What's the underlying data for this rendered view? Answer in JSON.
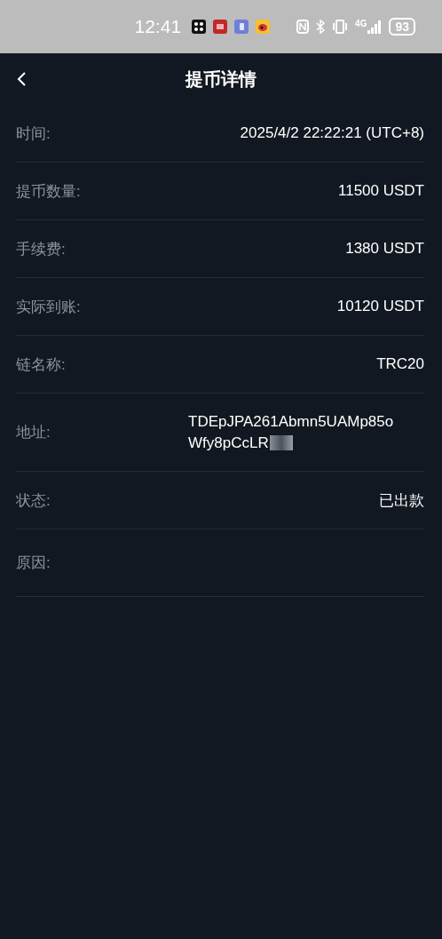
{
  "status_bar": {
    "time": "12:41",
    "network": "4G",
    "battery": "93"
  },
  "header": {
    "title": "提币详情"
  },
  "rows": [
    {
      "kind": "text",
      "label": "时间:",
      "value": "2025/4/2 22:22:21 (UTC+8)"
    },
    {
      "kind": "text",
      "label": "提币数量:",
      "value": "11500 USDT"
    },
    {
      "kind": "text",
      "label": "手续费:",
      "value": "1380 USDT"
    },
    {
      "kind": "text",
      "label": "实际到账:",
      "value": "10120 USDT"
    },
    {
      "kind": "text",
      "label": "链名称:",
      "value": "TRC20"
    },
    {
      "kind": "address",
      "label": "地址:",
      "lines": [
        "TDEpJPA261Abmn5UAMp85o",
        "Wfy8pCcLR"
      ]
    },
    {
      "kind": "text",
      "label": "状态:",
      "value": "已出款"
    },
    {
      "kind": "empty",
      "label": "原因:"
    }
  ]
}
